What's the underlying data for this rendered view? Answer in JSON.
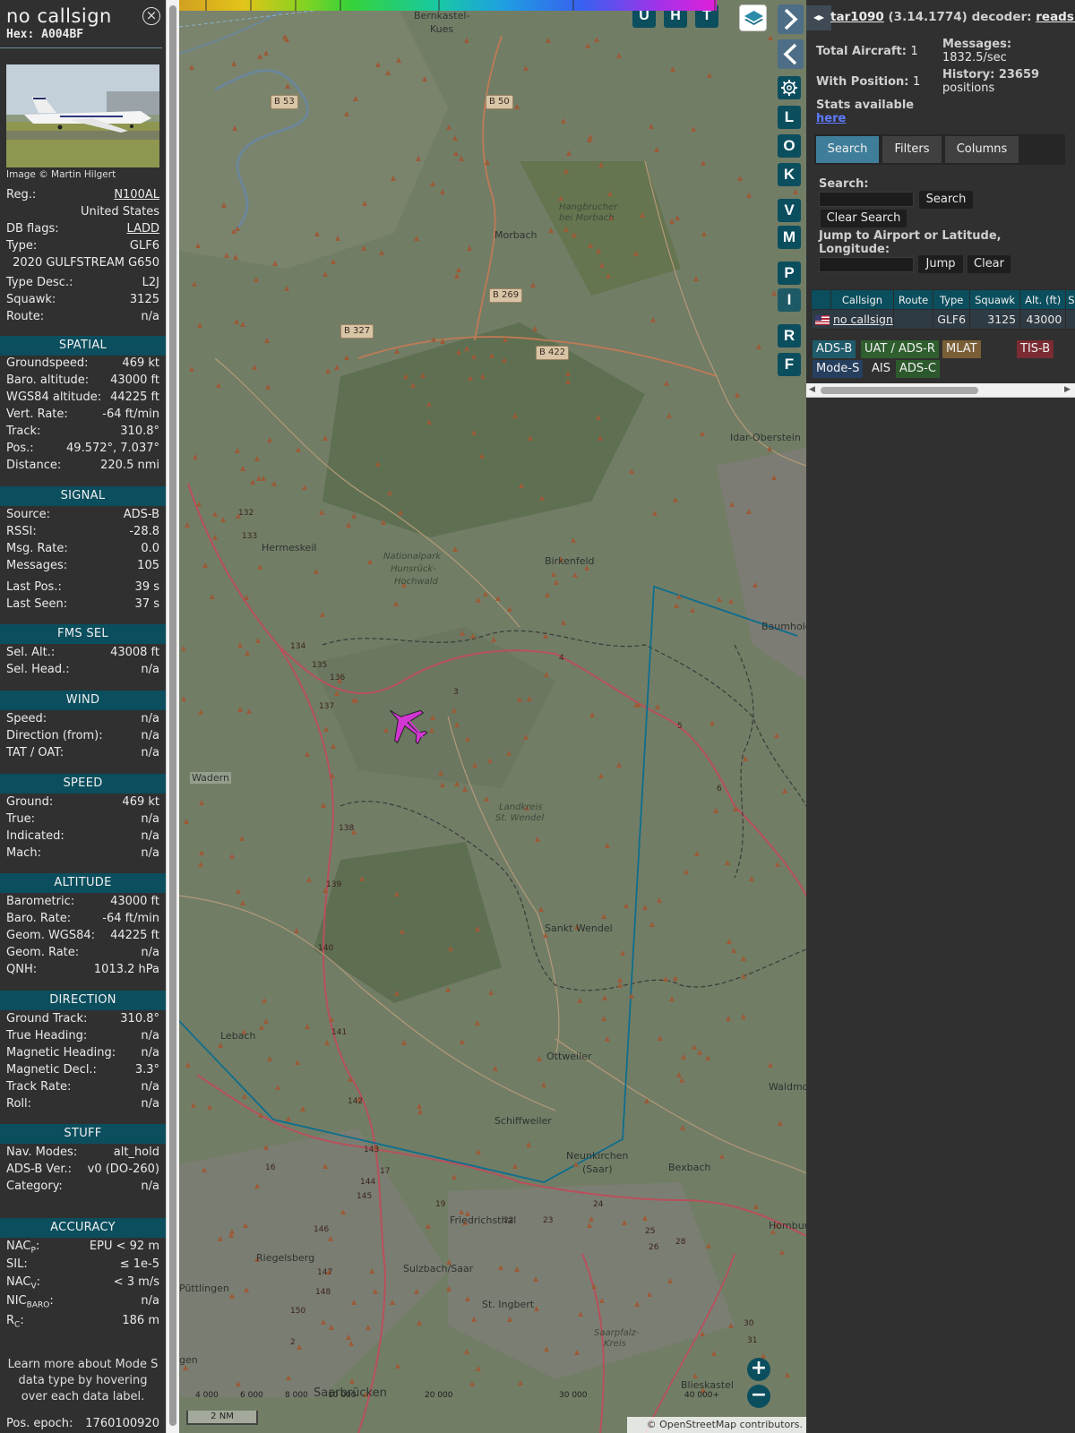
{
  "info": {
    "callsign": "no callsign",
    "hex": "Hex: A004BF",
    "close_icon": "×",
    "photo_credit": "Image © Martin Hilgert",
    "rows_top": [
      {
        "k": "Reg.:",
        "v": "N100AL",
        "link": true
      },
      {
        "k": "",
        "v": "United States"
      },
      {
        "k": "DB flags:",
        "v": "LADD",
        "link": true
      },
      {
        "k": "Type:",
        "v": "GLF6"
      },
      {
        "k": "",
        "v": "2020 GULFSTREAM G650"
      },
      {
        "k": "Type Desc.:",
        "v": "L2J"
      },
      {
        "k": "Squawk:",
        "v": "3125"
      },
      {
        "k": "Route:",
        "v": "n/a"
      }
    ],
    "sections": {
      "spatial": "SPATIAL",
      "signal": "SIGNAL",
      "fms": "FMS SEL",
      "wind": "WIND",
      "speed": "SPEED",
      "altitude": "ALTITUDE",
      "direction": "DIRECTION",
      "stuff": "STUFF",
      "accuracy": "ACCURACY"
    },
    "spatial": [
      {
        "k": "Groundspeed:",
        "v": "469 kt"
      },
      {
        "k": "Baro. altitude:",
        "v": "43000 ft"
      },
      {
        "k": "WGS84 altitude:",
        "v": "44225 ft"
      },
      {
        "k": "Vert. Rate:",
        "v": "-64 ft/min"
      },
      {
        "k": "Track:",
        "v": "310.8°"
      },
      {
        "k": "Pos.:",
        "v": "49.572°, 7.037°"
      },
      {
        "k": "Distance:",
        "v": "220.5 nmi"
      }
    ],
    "signal": [
      {
        "k": "Source:",
        "v": "ADS-B"
      },
      {
        "k": "RSSI:",
        "v": "-28.8"
      },
      {
        "k": "Msg. Rate:",
        "v": "0.0"
      },
      {
        "k": "Messages:",
        "v": "105"
      },
      {
        "k": "Last Pos.:",
        "v": "39 s"
      },
      {
        "k": "Last Seen:",
        "v": "37 s"
      }
    ],
    "fms": [
      {
        "k": "Sel. Alt.:",
        "v": "43008 ft"
      },
      {
        "k": "Sel. Head.:",
        "v": "n/a"
      }
    ],
    "wind": [
      {
        "k": "Speed:",
        "v": "n/a"
      },
      {
        "k": "Direction (from):",
        "v": "n/a"
      },
      {
        "k": "TAT / OAT:",
        "v": "n/a"
      }
    ],
    "speed": [
      {
        "k": "Ground:",
        "v": "469 kt"
      },
      {
        "k": "True:",
        "v": "n/a"
      },
      {
        "k": "Indicated:",
        "v": "n/a"
      },
      {
        "k": "Mach:",
        "v": "n/a"
      }
    ],
    "altitude": [
      {
        "k": "Barometric:",
        "v": "43000 ft"
      },
      {
        "k": "Baro. Rate:",
        "v": "-64 ft/min"
      },
      {
        "k": "Geom. WGS84:",
        "v": "44225 ft"
      },
      {
        "k": "Geom. Rate:",
        "v": "n/a"
      },
      {
        "k": "QNH:",
        "v": "1013.2 hPa"
      }
    ],
    "direction": [
      {
        "k": "Ground Track:",
        "v": "310.8°"
      },
      {
        "k": "True Heading:",
        "v": "n/a"
      },
      {
        "k": "Magnetic Heading:",
        "v": "n/a"
      },
      {
        "k": "Magnetic Decl.:",
        "v": "3.3°"
      },
      {
        "k": "Track Rate:",
        "v": "n/a"
      },
      {
        "k": "Roll:",
        "v": "n/a"
      }
    ],
    "stuff": [
      {
        "k": "Nav. Modes:",
        "v": "alt_hold"
      },
      {
        "k": "ADS-B Ver.:",
        "v": "v0 (DO-260)"
      },
      {
        "k": "Category:",
        "v": "n/a"
      }
    ],
    "accuracy": [
      {
        "k": "NAC",
        "sub": "P",
        "tail": ":",
        "v": "EPU < 92 m"
      },
      {
        "k": "SIL:",
        "v": "≤ 1e-5"
      },
      {
        "k": "NAC",
        "sub": "V",
        "tail": ":",
        "v": "< 3 m/s"
      },
      {
        "k": "NIC",
        "sub": "BARO",
        "tail": ":",
        "v": "n/a"
      },
      {
        "k": "R",
        "sub": "C",
        "tail": ":",
        "v": "186 m"
      }
    ],
    "learn_more": "Learn more about Mode S data type by hovering over each data label.",
    "epoch": {
      "k": "Pos. epoch:",
      "v": "1760100920"
    }
  },
  "map": {
    "top_buttons": [
      "U",
      "H",
      "T"
    ],
    "side_buttons": [
      "L",
      "O",
      "K",
      "V",
      "M",
      "P",
      "I",
      "R",
      "F"
    ],
    "places": [
      {
        "t": "Bernkastel-"
      },
      {
        "t": "Kues"
      },
      {
        "t": "Morbach"
      },
      {
        "t": "Idar-Oberstein"
      },
      {
        "t": "Hermeskeil"
      },
      {
        "t": "Birkenfeld"
      },
      {
        "t": "Baumhold"
      },
      {
        "t": "Wadern"
      },
      {
        "t": "Sankt Wendel"
      },
      {
        "t": "Lebach"
      },
      {
        "t": "Ottweiler"
      },
      {
        "t": "Waldmo"
      },
      {
        "t": "Schiffweiler"
      },
      {
        "t": "Neunkirchen"
      },
      {
        "t": "(Saar)"
      },
      {
        "t": "Bexbach"
      },
      {
        "t": "Friedrichsthal"
      },
      {
        "t": "Homburg"
      },
      {
        "t": "Riegelsberg"
      },
      {
        "t": "Sulzbach/Saar"
      },
      {
        "t": "Püttlingen"
      },
      {
        "t": "St. Ingbert"
      },
      {
        "t": "Saarbrücken"
      },
      {
        "t": "Blieskastel"
      },
      {
        "t": "gen"
      }
    ],
    "areas": [
      "Hangbrucher",
      "bei Morbach",
      "Nationalpark",
      "Hunsrück-",
      "Hochwald",
      "Landkreis",
      "St. Wendel",
      "Saarpfalz-",
      "Kreis"
    ],
    "roads": [
      "B 53",
      "B 50",
      "B 269",
      "B 327",
      "B 422"
    ],
    "road_numbers": [
      "132",
      "133",
      "134",
      "135",
      "136",
      "137",
      "138",
      "139",
      "140",
      "141",
      "142",
      "143",
      "144",
      "145",
      "146",
      "147",
      "148",
      "150",
      "2",
      "3",
      "4",
      "5",
      "6",
      "16",
      "17",
      "19",
      "22",
      "23",
      "24",
      "25",
      "26",
      "28",
      "30",
      "31"
    ],
    "alt_labels": [
      "4 000",
      "6 000",
      "8 000",
      "10 000",
      "20 000",
      "30 000",
      "40 000+"
    ],
    "scale": "2 NM",
    "zoom_in": "+",
    "zoom_out": "−",
    "attribution": "© OpenStreetMap contributors.",
    "plane_track_deg": 310.8,
    "plane_color": "#d236d2",
    "range_color": "#0e6e8e"
  },
  "side": {
    "handle": "◂▸",
    "title_link": "tar1090",
    "version": "(3.14.1774)",
    "decoder_label": "decoder:",
    "decoder_link": "readsb",
    "total_aircraft_label": "Total Aircraft:",
    "total_aircraft": "1",
    "with_position_label": "With Position:",
    "with_position": "1",
    "messages_label": "Messages:",
    "messages": "1832.5/sec",
    "history_label": "History: 23659",
    "history": "positions",
    "stats_label": "Stats available",
    "stats_link": "here",
    "tabs": [
      "Search",
      "Filters",
      "Columns"
    ],
    "search_label": "Search:",
    "search_value": "",
    "search_btn": "Search",
    "clear_search_btn": "Clear Search",
    "jump_label": "Jump to Airport or Latitude, Longitude:",
    "jump_value": "",
    "jump_btn": "Jump",
    "clear_btn": "Clear",
    "columns": [
      "Callsign",
      "Route",
      "Type",
      "Squawk",
      "Alt. (ft)",
      "S"
    ],
    "rows": [
      {
        "callsign": "no callsign",
        "route": "",
        "type": "GLF6",
        "squawk": "3125",
        "alt": "43000"
      }
    ],
    "legend": [
      {
        "t": "ADS-B",
        "c": "#1f5b6b"
      },
      {
        "t": "UAT / ADS-R",
        "c": "#2f5e2f"
      },
      {
        "t": "MLAT",
        "c": "#7a5f36"
      },
      {
        "t": "TIS-B",
        "c": "#7b2b33"
      },
      {
        "t": "Mode-S",
        "c": "#263f5f"
      },
      {
        "t": "AIS",
        "c": "#303030"
      },
      {
        "t": "ADS-C",
        "c": "#2d5a2d"
      }
    ]
  }
}
